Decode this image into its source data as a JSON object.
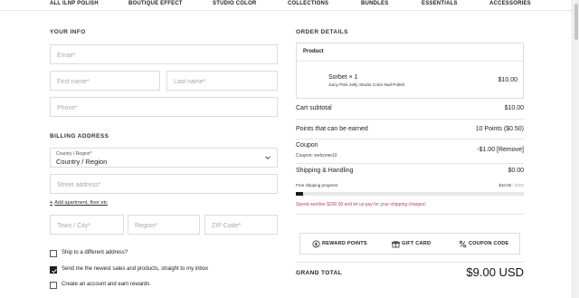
{
  "nav": {
    "items": [
      "ALL ILNP POLISH",
      "BOUTIQUE EFFECT",
      "STUDIO COLOR",
      "COLLECTIONS",
      "BUNDLES",
      "ESSENTIALS",
      "ACCESSORIES"
    ]
  },
  "your_info": {
    "title": "YOUR INFO",
    "email_placeholder": "Email*",
    "first_name_placeholder": "First name*",
    "last_name_placeholder": "Last name*",
    "phone_placeholder": "Phone*"
  },
  "billing": {
    "title": "BILLING ADDRESS",
    "country_label": "Country / Region*",
    "country_value": "Country / Region",
    "street_placeholder": "Street address*",
    "add_apartment": "Add apartment, floor etc",
    "city_placeholder": "Town / City*",
    "region_placeholder": "Region*",
    "zip_placeholder": "ZIP Code*"
  },
  "options": [
    {
      "label": "Ship to a different address?",
      "checked": false
    },
    {
      "label": "Send me the newest sales and products, straight to my inbox",
      "checked": true
    },
    {
      "label": "Create an account and earn rewards",
      "checked": false
    }
  ],
  "order": {
    "title": "ORDER DETAILS",
    "product_header": "Product",
    "product_name": "Sorbet × 1",
    "product_sub": "Juicy Pink Jelly Studio Color Nail Polish",
    "product_price": "$10.00",
    "cart_subtotal_label": "Cart subtotal",
    "cart_subtotal_value": "$10.00",
    "points_label": "Points that can be earned",
    "points_value": "10 Points ($0.50)",
    "coupon_label": "Coupon",
    "coupon_value": "-$1.00 [Remove]",
    "coupon_code": "Coupon: welcome10",
    "shipping_label": "Shipping & Handling",
    "shipping_value": "$0.00",
    "progress_label": "Free shipping progress:",
    "progress_current": "$10.00",
    "progress_sep": "/",
    "progress_target": "$300",
    "progress_fraction": 0.0333,
    "spend_message": "Spend another $290.00 and let us pay for your shipping charges!",
    "grand_total_label": "GRAND TOTAL",
    "grand_total_value": "$9.00 USD"
  },
  "actions": {
    "reward_points": "REWARD POINTS",
    "gift_card": "GIFT CARD",
    "coupon_code": "COUPON CODE"
  },
  "colors": {
    "accent_message": "#c8367d",
    "checkbox_checked": "#1f1f1f"
  }
}
